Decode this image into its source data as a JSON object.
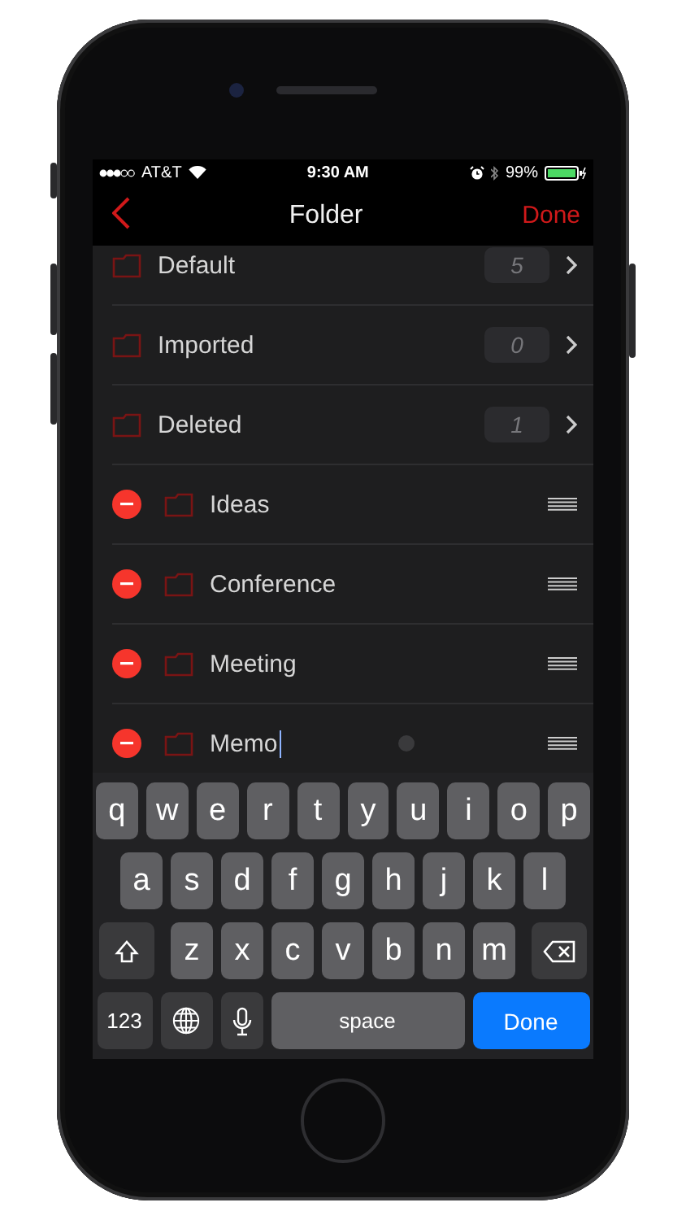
{
  "status_bar": {
    "carrier": "AT&T",
    "time": "9:30 AM",
    "battery": "99%"
  },
  "nav": {
    "title": "Folder",
    "action": "Done"
  },
  "folders": [
    {
      "kind": "fixed",
      "name": "Default",
      "count": "5"
    },
    {
      "kind": "fixed",
      "name": "Imported",
      "count": "0"
    },
    {
      "kind": "fixed",
      "name": "Deleted",
      "count": "1"
    },
    {
      "kind": "editable",
      "name": "Ideas",
      "editing": false
    },
    {
      "kind": "editable",
      "name": "Conference",
      "editing": false
    },
    {
      "kind": "editable",
      "name": "Meeting",
      "editing": false
    },
    {
      "kind": "editable",
      "name": "Memo",
      "editing": true
    }
  ],
  "keyboard": [
    [
      {
        "kind": "letter",
        "label": "q"
      },
      {
        "kind": "letter",
        "label": "w"
      },
      {
        "kind": "letter",
        "label": "e"
      },
      {
        "kind": "letter",
        "label": "r"
      },
      {
        "kind": "letter",
        "label": "t"
      },
      {
        "kind": "letter",
        "label": "y"
      },
      {
        "kind": "letter",
        "label": "u"
      },
      {
        "kind": "letter",
        "label": "i"
      },
      {
        "kind": "letter",
        "label": "o"
      },
      {
        "kind": "letter",
        "label": "p"
      }
    ],
    [
      {
        "kind": "letter",
        "label": "a"
      },
      {
        "kind": "letter",
        "label": "s"
      },
      {
        "kind": "letter",
        "label": "d"
      },
      {
        "kind": "letter",
        "label": "f"
      },
      {
        "kind": "letter",
        "label": "g"
      },
      {
        "kind": "letter",
        "label": "h"
      },
      {
        "kind": "letter",
        "label": "j"
      },
      {
        "kind": "letter",
        "label": "k"
      },
      {
        "kind": "letter",
        "label": "l"
      }
    ],
    [
      {
        "kind": "shift"
      },
      {
        "kind": "letter",
        "label": "z"
      },
      {
        "kind": "letter",
        "label": "x"
      },
      {
        "kind": "letter",
        "label": "c"
      },
      {
        "kind": "letter",
        "label": "v"
      },
      {
        "kind": "letter",
        "label": "b"
      },
      {
        "kind": "letter",
        "label": "n"
      },
      {
        "kind": "letter",
        "label": "m"
      },
      {
        "kind": "delete"
      }
    ],
    [
      {
        "kind": "numbers",
        "label": "123"
      },
      {
        "kind": "globe"
      },
      {
        "kind": "mic"
      },
      {
        "kind": "space",
        "label": "space"
      },
      {
        "kind": "return",
        "label": "Done"
      }
    ]
  ]
}
